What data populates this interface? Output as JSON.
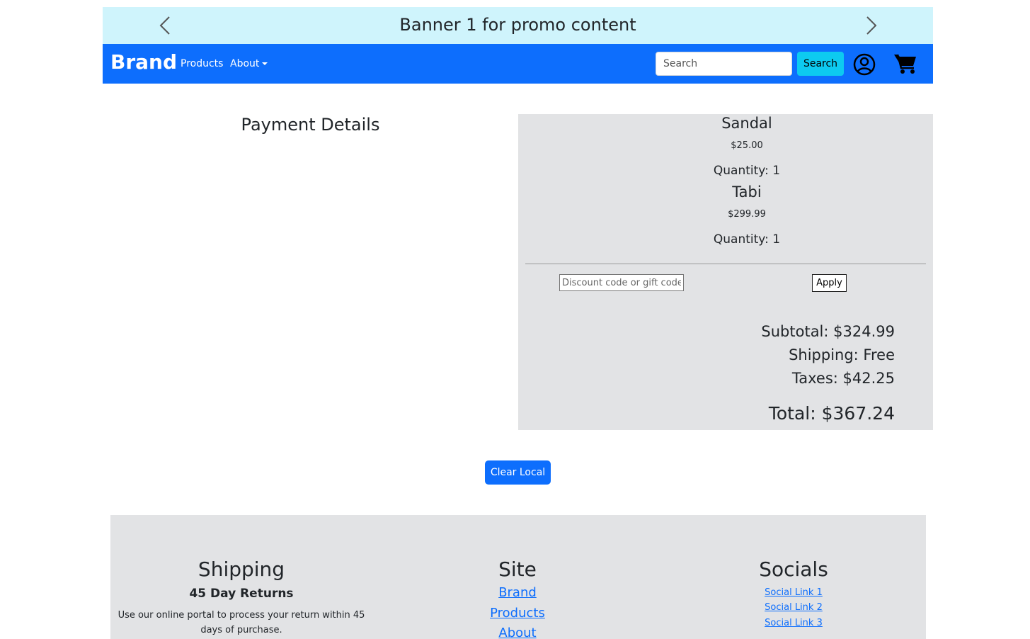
{
  "promo": {
    "text": "Banner 1 for promo content",
    "prev_icon": "chevron-left-icon",
    "next_icon": "chevron-right-icon",
    "background": "#cff4fc"
  },
  "navbar": {
    "brand": "Brand",
    "links": {
      "products": "Products",
      "about": "About"
    },
    "search_placeholder": "Search",
    "search_button": "Search",
    "user_icon": "user-circle-icon",
    "cart_icon": "cart-icon",
    "background": "#0d6efd",
    "search_button_color": "#0dcaf0"
  },
  "payment": {
    "title": "Payment Details"
  },
  "order": {
    "items": [
      {
        "name": "Sandal",
        "price": "$25.00",
        "quantity": "Quantity: 1"
      },
      {
        "name": "Tabi",
        "price": "$299.99",
        "quantity": "Quantity: 1"
      }
    ],
    "discount_placeholder": "Discount code or gift code",
    "apply_label": "Apply",
    "subtotal": "Subtotal: $324.99",
    "shipping": "Shipping: Free",
    "taxes": "Taxes: $42.25",
    "total": "Total: $367.24"
  },
  "actions": {
    "clear_local": "Clear Local"
  },
  "footer": {
    "shipping": {
      "title": "Shipping",
      "subtitle": "45 Day Returns",
      "text": "Use our online portal to process your return within 45 days of purchase."
    },
    "site": {
      "title": "Site",
      "links": [
        "Brand",
        "Products",
        "About"
      ]
    },
    "socials": {
      "title": "Socials",
      "links": [
        "Social Link 1",
        "Social Link 2",
        "Social Link 3"
      ]
    },
    "background": "#e2e3e5"
  }
}
